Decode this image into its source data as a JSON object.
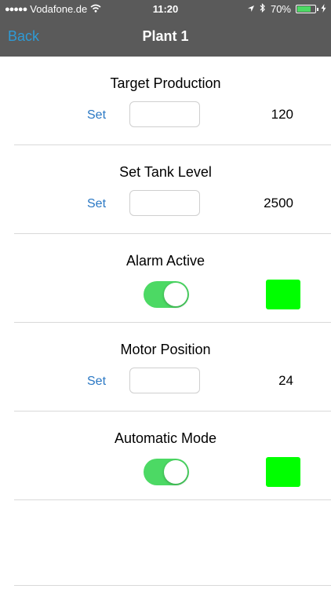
{
  "status_bar": {
    "carrier": "Vodafone.de",
    "time": "11:20",
    "battery_percent": "70%",
    "battery_level": 0.7
  },
  "nav": {
    "back_label": "Back",
    "title": "Plant 1"
  },
  "rows": [
    {
      "title": "Target Production",
      "set_label": "Set",
      "input_value": "",
      "value": "120"
    },
    {
      "title": "Set Tank Level",
      "set_label": "Set",
      "input_value": "",
      "value": "2500"
    },
    {
      "title": "Alarm Active",
      "toggle_on": true,
      "indicator_color": "#00ff00"
    },
    {
      "title": "Motor Position",
      "set_label": "Set",
      "input_value": "",
      "value": "24"
    },
    {
      "title": "Automatic Mode",
      "toggle_on": true,
      "indicator_color": "#00ff00"
    }
  ],
  "colors": {
    "nav_bg": "#5a5a5a",
    "link": "#2a78c4",
    "toggle_on": "#4cd964",
    "indicator_on": "#00ff00"
  }
}
